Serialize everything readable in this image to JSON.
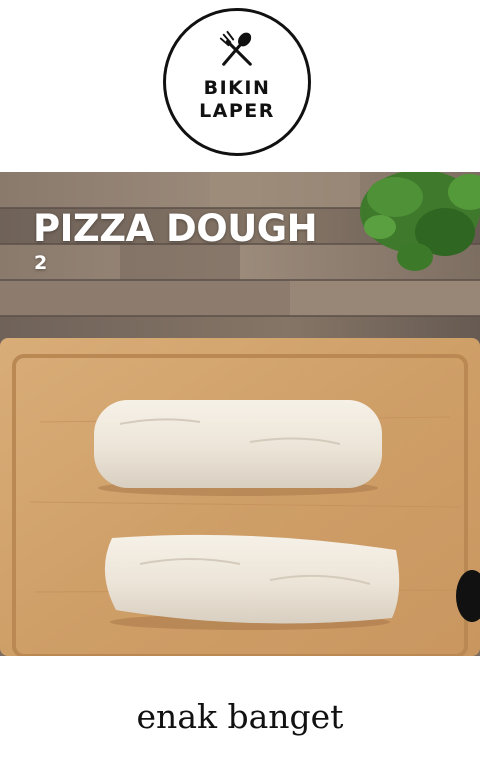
{
  "logo": {
    "line1": "BIKIN",
    "line2": "LAPER",
    "icon": "fork-spoon-icon"
  },
  "video": {
    "title": "PIZZA DOUGH",
    "step": "2"
  },
  "caption": "enak banget"
}
